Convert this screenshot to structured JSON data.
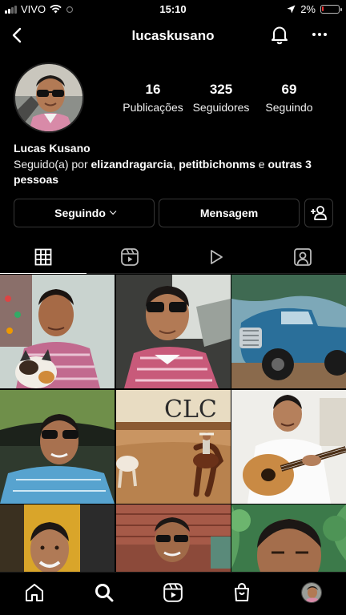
{
  "status_bar": {
    "carrier": "VIVO",
    "time": "15:10",
    "battery": "2%",
    "battery_level": 0.02
  },
  "header": {
    "username": "lucaskusano",
    "back_icon": "chevron-left-icon",
    "notify_icon": "bell-icon",
    "more_icon": "more-horizontal-icon"
  },
  "profile": {
    "posts_count": "16",
    "posts_label": "Publicações",
    "followers_count": "325",
    "followers_label": "Seguidores",
    "following_count": "69",
    "following_label": "Seguindo",
    "name": "Lucas Kusano",
    "followed_prefix": "Seguido(a) por ",
    "followed_user_1": "elizandragarcia",
    "followed_sep": ", ",
    "followed_user_2": "petitbichonms",
    "followed_and": " e ",
    "followed_others": "outras 3 pessoas"
  },
  "actions": {
    "following_label": "Seguindo",
    "message_label": "Mensagem",
    "add_user_icon": "add-user-icon"
  },
  "tabs": [
    {
      "name": "grid",
      "icon": "grid-icon",
      "active": true
    },
    {
      "name": "reels",
      "icon": "reels-icon",
      "active": false
    },
    {
      "name": "videos",
      "icon": "play-icon",
      "active": false
    },
    {
      "name": "tagged",
      "icon": "tagged-icon",
      "active": false
    }
  ],
  "posts": [
    {
      "id": "selfie-with-cat"
    },
    {
      "id": "car-selfie-sunglasses"
    },
    {
      "id": "blue-vintage-truck"
    },
    {
      "id": "car-selfie-blue-shirt"
    },
    {
      "id": "rodeo-arena",
      "text": "CLC"
    },
    {
      "id": "playing-guitar"
    },
    {
      "id": "selfie-yellow-background"
    },
    {
      "id": "man-with-sunglasses-street"
    },
    {
      "id": "close-up-selfie-plants"
    }
  ],
  "bottom_nav": [
    "home-icon",
    "search-icon",
    "reels-icon",
    "shop-icon",
    "profile-avatar"
  ],
  "colors": {
    "background": "#000000",
    "text": "#ffffff",
    "border": "#363636",
    "battery_low": "#e33333"
  }
}
